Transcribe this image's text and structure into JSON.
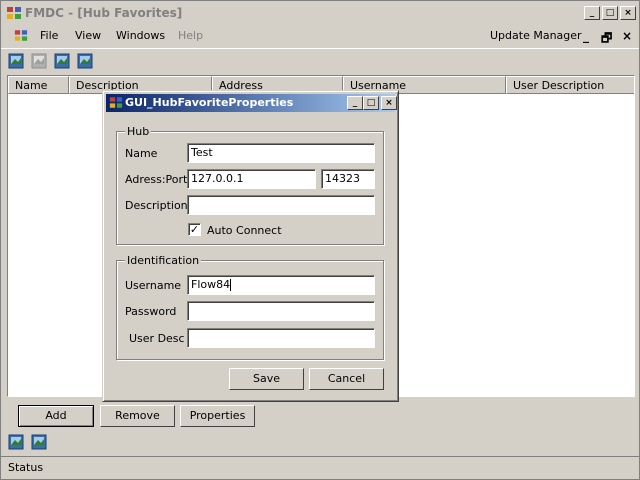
{
  "window": {
    "title": "FMDC - [Hub Favorites]",
    "controls": [
      "_",
      "□",
      "×"
    ]
  },
  "menu": {
    "items": [
      "File",
      "View",
      "Windows",
      "Help"
    ],
    "right_item": "Update Manager",
    "mdi_controls": [
      "_",
      "🗗",
      "×"
    ]
  },
  "listview": {
    "columns": [
      "Name",
      "Description",
      "Address",
      "Username",
      "User Description"
    ]
  },
  "buttons": {
    "add": "Add",
    "remove": "Remove",
    "properties": "Properties"
  },
  "status": {
    "text": "Status"
  },
  "dialog": {
    "title": "GUI_HubFavoriteProperties",
    "hub_group": {
      "legend": "Hub",
      "name_label": "Name",
      "name_value": "Test",
      "address_label": "Adress:Port",
      "address_value": "127.0.0.1",
      "port_value": "14323",
      "description_label": "Description",
      "description_value": "",
      "auto_connect_label": "Auto Connect",
      "auto_connect_checked": "✓"
    },
    "identification_group": {
      "legend": "Identification",
      "username_label": "Username",
      "username_value": "Flow84",
      "password_label": "Password",
      "password_value": "",
      "userdesc_label": "User Desc",
      "userdesc_value": ""
    },
    "save_label": "Save",
    "cancel_label": "Cancel"
  },
  "colors": {
    "dialog_title_start": "#0a246a",
    "dialog_title_end": "#a6caf0",
    "face": "#d4d0c8"
  }
}
